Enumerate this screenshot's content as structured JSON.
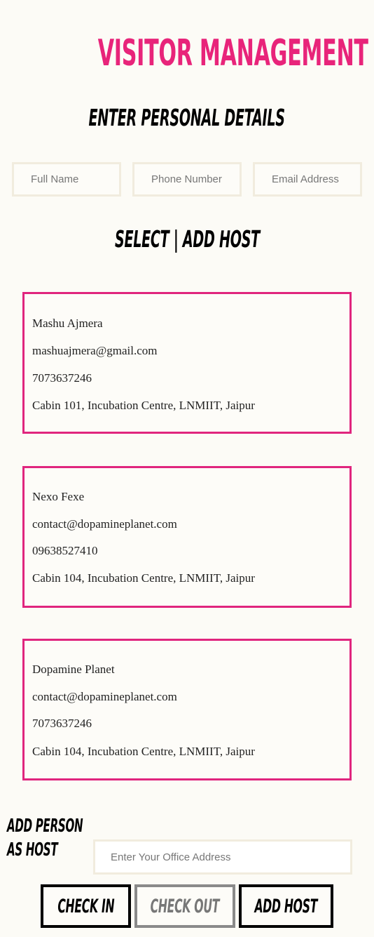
{
  "header": {
    "title": "VISITOR MANAGEMENT"
  },
  "personal": {
    "heading": "ENTER PERSONAL DETAILS",
    "full_name_placeholder": "Full Name",
    "phone_placeholder": "Phone Number",
    "email_placeholder": "Email Address"
  },
  "hosts": {
    "heading": "SELECT | ADD HOST",
    "items": [
      {
        "name": "Mashu Ajmera",
        "email": "mashuajmera@gmail.com",
        "phone": "7073637246",
        "address": "Cabin 101, Incubation Centre, LNMIIT, Jaipur"
      },
      {
        "name": "Nexo Fexe",
        "email": "contact@dopamineplanet.com",
        "phone": "09638527410",
        "address": "Cabin 104, Incubation Centre, LNMIIT, Jaipur"
      },
      {
        "name": "Dopamine Planet",
        "email": "contact@dopamineplanet.com",
        "phone": "7073637246",
        "address": "Cabin 104, Incubation Centre, LNMIIT, Jaipur"
      }
    ]
  },
  "add_host": {
    "label_line1": "ADD PERSON",
    "label_line2": "AS HOST",
    "office_placeholder": "Enter Your Office Address"
  },
  "actions": {
    "check_in": "CHECK IN",
    "check_out": "CHECK OUT",
    "add_host": "ADD HOST"
  },
  "colors": {
    "accent": "#e8247a",
    "card_border": "#e0257e",
    "background": "#fcfbf6"
  }
}
